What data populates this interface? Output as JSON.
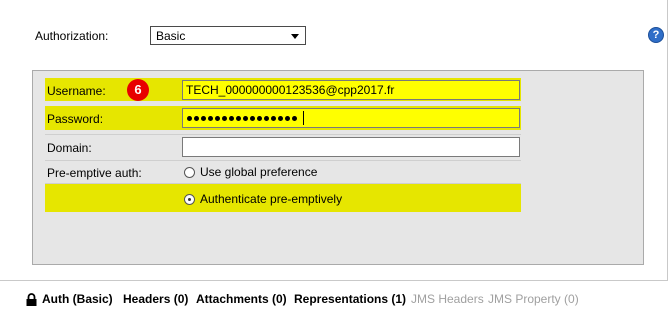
{
  "authorization": {
    "label": "Authorization:",
    "selected": "Basic",
    "help_icon": "help-icon"
  },
  "form": {
    "badge": "6",
    "username_label": "Username:",
    "username_value": "TECH_000000000123536@cpp2017.fr",
    "password_label": "Password:",
    "password_masked_length": 16,
    "domain_label": "Domain:",
    "domain_value": "",
    "preemptive_label": "Pre-emptive auth:",
    "option_global": "Use global preference",
    "option_preemptive": "Authenticate pre-emptively",
    "selected_option": "Authenticate pre-emptively"
  },
  "highlight_color": "#e6e600",
  "tabs": [
    {
      "label": "Auth (Basic)",
      "icon": "lock-icon",
      "enabled": true
    },
    {
      "label": "Headers (0)",
      "enabled": true
    },
    {
      "label": "Attachments (0)",
      "enabled": true
    },
    {
      "label": "Representations (1)",
      "enabled": true
    },
    {
      "label": "JMS Headers",
      "enabled": false
    },
    {
      "label": "JMS Property (0)",
      "enabled": false
    }
  ]
}
